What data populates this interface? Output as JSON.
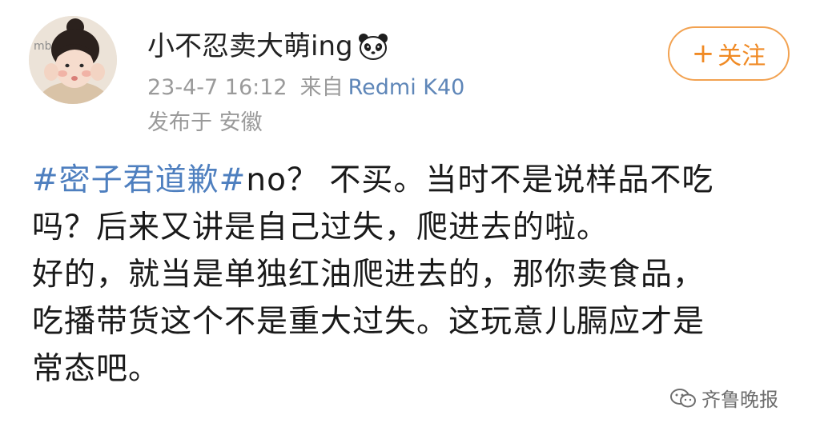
{
  "user": {
    "name": "小不忍卖大萌ing",
    "name_emoji_icon": "panda-icon",
    "avatar_icon": "avatar-photo"
  },
  "meta": {
    "time": "23-4-7 16:12",
    "source_prefix": "来自",
    "device": "Redmi K40",
    "location": "发布于 安徽"
  },
  "follow_button": {
    "plus": "+",
    "label": "关注",
    "color": "#f08a24"
  },
  "post": {
    "line1_hashtag": "#密子君道歉#",
    "line1_rest": "no？ 不买。当时不是说样品不吃",
    "line2": "吗？后来又讲是自己过失，爬进去的啦。",
    "line3": "好的，就当是单独红油爬进去的，那你卖食品，",
    "line4": "吃播带货这个不是重大过失。这玩意儿膈应才是",
    "line5": "常态吧。"
  },
  "watermark": {
    "label": "齐鲁晚报",
    "icon": "wechat-icon"
  },
  "colors": {
    "hashtag": "#4e7fbf",
    "device_link": "#5e86b8",
    "meta_gray": "#9a9a9a"
  }
}
